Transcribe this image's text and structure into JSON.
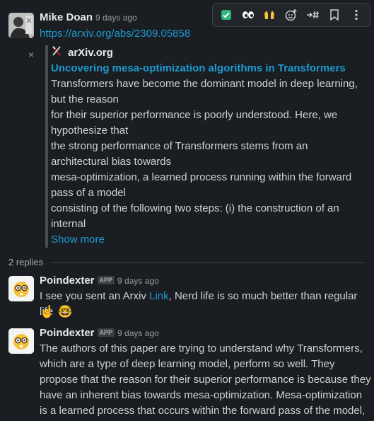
{
  "toolbar": {
    "icons": [
      "check-mark-icon",
      "eyes-icon",
      "raised-hands-icon",
      "add-reaction-icon",
      "forward-to-channel-icon",
      "bookmark-icon",
      "more-actions-icon"
    ]
  },
  "message1": {
    "author": "Mike Doan",
    "timestamp": "9 days ago",
    "link": "https://arxiv.org/abs/2309.05858"
  },
  "unfurl": {
    "source": "arXiv.org",
    "title": "Uncovering mesa-optimization algorithms in Transformers",
    "body": "Transformers have become the dominant model in deep learning, but the reason\nfor their superior performance is poorly understood. Here, we hypothesize that\nthe strong performance of Transformers stems from an architectural bias towards\nmesa-optimization, a learned process running within the forward pass of a model\nconsisting of the following two steps: (i) the construction of an internal",
    "show_more": "Show more",
    "close": "×"
  },
  "thread": {
    "replies_label": "2 replies"
  },
  "reply1": {
    "author": "Poindexter",
    "badge": "APP",
    "timestamp": "9 days ago",
    "text_before": "I see you sent an Arxiv ",
    "link_text": "Link",
    "text_after": ", Nerd life is so much better than regular life",
    "emoji": "☝️ 🤓"
  },
  "reply2": {
    "author": "Poindexter",
    "badge": "APP",
    "timestamp": "9 days ago",
    "text": "The authors of this paper are trying to understand why Transformers, which are a type of deep learning model, perform so well. They propose that the reason for their superior performance is because they have an inherent bias towards mesa-optimization. Mesa-optimization is a learned process that occurs within the forward pass of the model,"
  },
  "colors": {
    "background": "#1a1d21",
    "link": "#1d9bd1",
    "avatar_bot": "#f4f4f4"
  }
}
